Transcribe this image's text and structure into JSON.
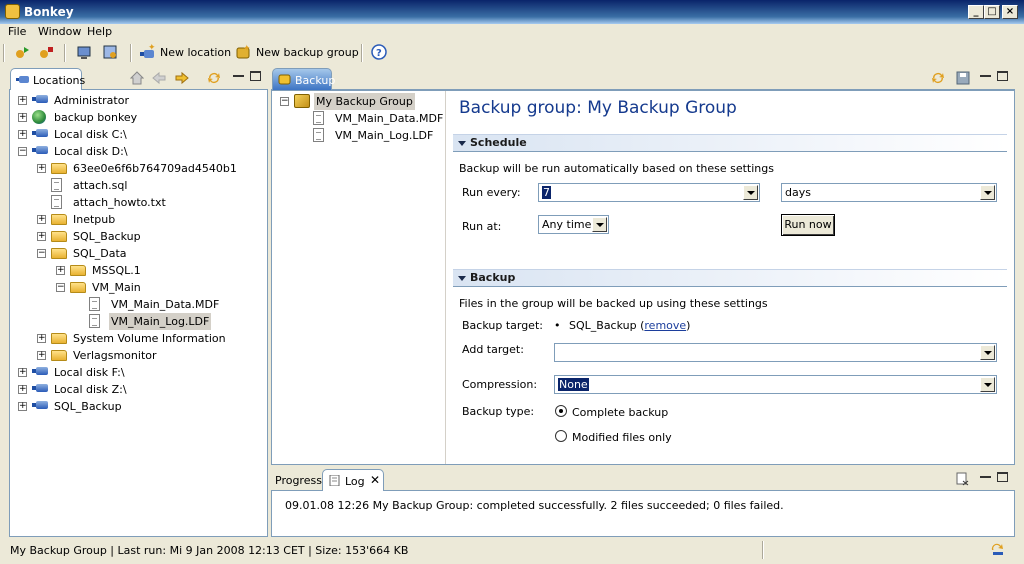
{
  "window": {
    "title": "Bonkey"
  },
  "menu": [
    {
      "label": "File"
    },
    {
      "label": "Window"
    },
    {
      "label": "Help"
    }
  ],
  "toolbar": {
    "new_location": "New location",
    "new_backup_group": "New backup group"
  },
  "locations_panel": {
    "tab": "Locations",
    "tree": [
      {
        "label": "Administrator",
        "icon": "drive-icon",
        "level": 0,
        "expander": "+"
      },
      {
        "label": "backup bonkey",
        "icon": "globe-icon",
        "level": 0,
        "expander": "+"
      },
      {
        "label": "Local disk C:\\",
        "icon": "drive-icon",
        "level": 0,
        "expander": "+"
      },
      {
        "label": "Local disk D:\\",
        "icon": "drive-icon",
        "level": 0,
        "expander": "−"
      },
      {
        "label": "63ee0e6f6b764709ad4540b1",
        "icon": "folder-icon",
        "level": 1,
        "expander": "+"
      },
      {
        "label": "attach.sql",
        "icon": "file-icon",
        "level": 1,
        "expander": ""
      },
      {
        "label": "attach_howto.txt",
        "icon": "file-icon",
        "level": 1,
        "expander": ""
      },
      {
        "label": "Inetpub",
        "icon": "folder-icon",
        "level": 1,
        "expander": "+"
      },
      {
        "label": "SQL_Backup",
        "icon": "folder-icon",
        "level": 1,
        "expander": "+"
      },
      {
        "label": "SQL_Data",
        "icon": "folder-icon",
        "level": 1,
        "expander": "−"
      },
      {
        "label": "MSSQL.1",
        "icon": "folder-icon",
        "level": 2,
        "expander": "+"
      },
      {
        "label": "VM_Main",
        "icon": "folder-icon",
        "level": 2,
        "expander": "−"
      },
      {
        "label": "VM_Main_Data.MDF",
        "icon": "file-icon",
        "level": 3,
        "expander": ""
      },
      {
        "label": "VM_Main_Log.LDF",
        "icon": "file-icon",
        "level": 3,
        "expander": "",
        "selected": true
      },
      {
        "label": "System Volume Information",
        "icon": "folder-icon",
        "level": 1,
        "expander": "+"
      },
      {
        "label": "Verlagsmonitor",
        "icon": "folder-icon",
        "level": 1,
        "expander": "+"
      },
      {
        "label": "Local disk F:\\",
        "icon": "drive-icon",
        "level": 0,
        "expander": "+"
      },
      {
        "label": "Local disk Z:\\",
        "icon": "drive-icon",
        "level": 0,
        "expander": "+"
      },
      {
        "label": "SQL_Backup",
        "icon": "drive-icon",
        "level": 0,
        "expander": "+"
      }
    ]
  },
  "backup_panel": {
    "tab": "Backup",
    "tree": [
      {
        "label": "My Backup Group",
        "icon": "group-icon",
        "level": 0,
        "expander": "−",
        "selected": true
      },
      {
        "label": "VM_Main_Data.MDF",
        "icon": "file-icon",
        "level": 1,
        "expander": ""
      },
      {
        "label": "VM_Main_Log.LDF",
        "icon": "file-icon",
        "level": 1,
        "expander": ""
      }
    ],
    "heading": "Backup group: My Backup Group",
    "schedule": {
      "title": "Schedule",
      "description": "Backup will be run automatically based on these settings",
      "run_every_label": "Run every:",
      "run_every_value": "7",
      "unit_value": "days",
      "run_at_label": "Run at:",
      "run_at_value": "Any time",
      "run_now": "Run now"
    },
    "backup": {
      "title": "Backup",
      "description": "Files in the group will be backed up using these settings",
      "target_label": "Backup target:",
      "target_value": "SQL_Backup",
      "remove_link": "remove",
      "add_target_label": "Add target:",
      "add_target_value": "",
      "compression_label": "Compression:",
      "compression_value": "None",
      "type_label": "Backup type:",
      "type_options": [
        {
          "label": "Complete backup",
          "selected": true
        },
        {
          "label": "Modified files only",
          "selected": false
        }
      ]
    }
  },
  "bottom_panel": {
    "tabs": [
      {
        "label": "Progress"
      },
      {
        "label": "Log"
      }
    ],
    "log_lines": [
      "09.01.08 12:26 My Backup Group: completed successfully. 2 files succeeded; 0 files failed."
    ]
  },
  "status_bar": {
    "text": "My Backup Group | Last run: Mi 9 Jan 2008 12:13 CET | Size: 153'664 KB"
  }
}
